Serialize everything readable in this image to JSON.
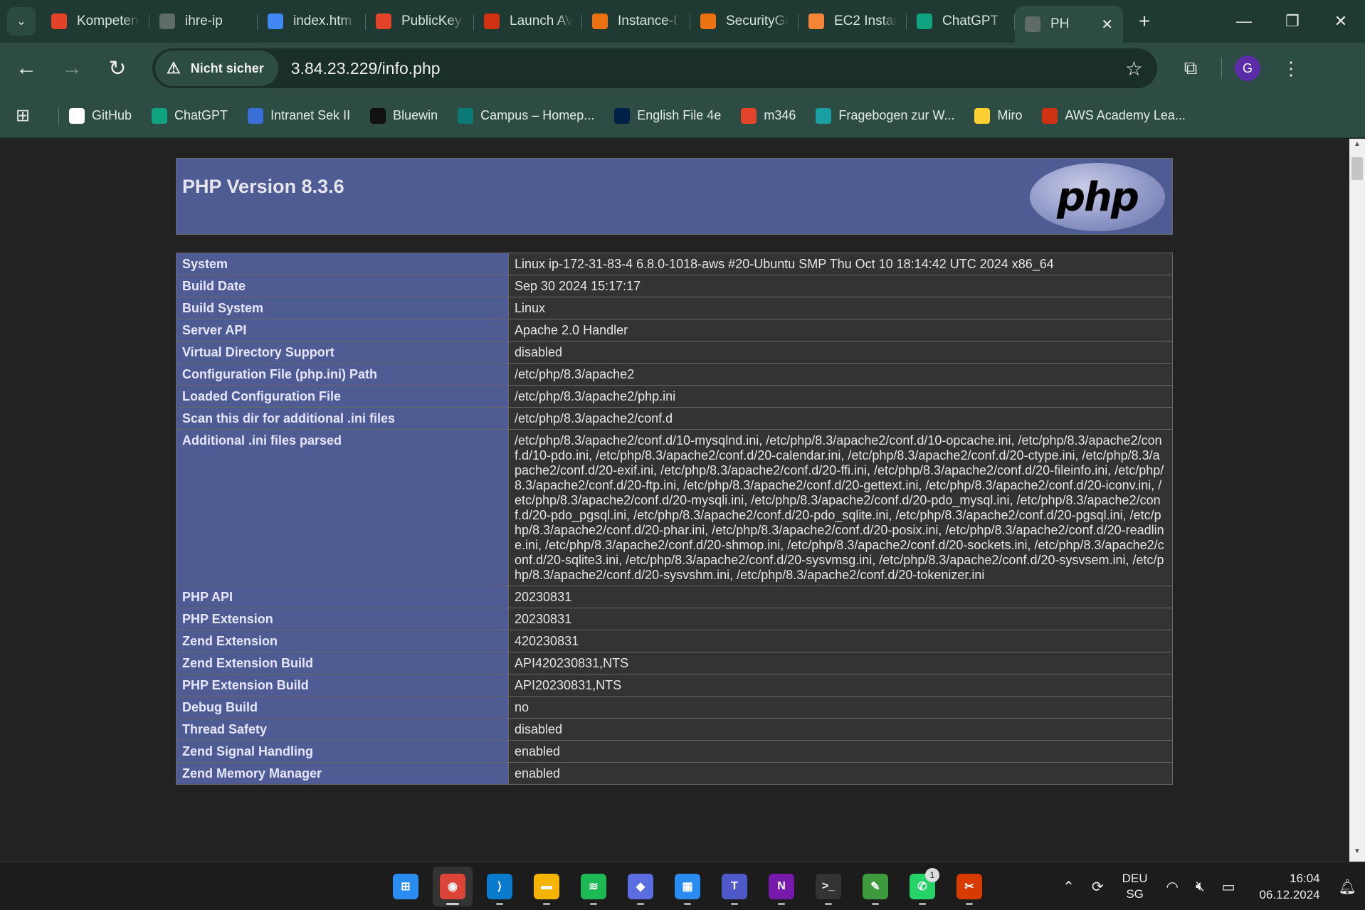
{
  "browser": {
    "tabs": [
      {
        "title": "Kompeten",
        "icon": "gitlab-icon",
        "color": "#e24329"
      },
      {
        "title": "ihre-ip",
        "icon": "globe-icon",
        "color": "#5f6b66"
      },
      {
        "title": "index.htm",
        "icon": "google-icon",
        "color": "#4285f4"
      },
      {
        "title": "PublicKey",
        "icon": "gitlab-icon",
        "color": "#e24329"
      },
      {
        "title": "Launch AV",
        "icon": "aws-academy-icon",
        "color": "#d13212"
      },
      {
        "title": "Instance-I",
        "icon": "aws-icon",
        "color": "#ec7211"
      },
      {
        "title": "SecurityGr",
        "icon": "aws-icon",
        "color": "#ec7211"
      },
      {
        "title": "EC2 Instan",
        "icon": "ec2-icon",
        "color": "#f58536"
      },
      {
        "title": "ChatGPT",
        "icon": "chatgpt-icon",
        "color": "#10a37f"
      },
      {
        "title": "PH",
        "icon": "globe-icon",
        "color": "#5f6b66",
        "active": true
      }
    ],
    "address": {
      "security_label": "Nicht sicher",
      "url": "3.84.23.229/info.php"
    },
    "profile_initial": "G",
    "bookmarks": [
      {
        "label": "GitHub",
        "icon": "github-icon",
        "color": "#ffffff"
      },
      {
        "label": "ChatGPT",
        "icon": "chatgpt-icon",
        "color": "#10a37f"
      },
      {
        "label": "Intranet Sek II",
        "icon": "intranet-icon",
        "color": "#3b6fd8"
      },
      {
        "label": "Bluewin",
        "icon": "bluewin-icon",
        "color": "#111111"
      },
      {
        "label": "Campus – Homep...",
        "icon": "sharepoint-icon",
        "color": "#0b7a75"
      },
      {
        "label": "English File 4e",
        "icon": "oxford-icon",
        "color": "#002147"
      },
      {
        "label": "m346",
        "icon": "gitlab-icon",
        "color": "#e24329"
      },
      {
        "label": "Fragebogen zur W...",
        "icon": "form-icon",
        "color": "#1aa0a3"
      },
      {
        "label": "Miro",
        "icon": "miro-icon",
        "color": "#ffd02f"
      },
      {
        "label": "AWS Academy Lea...",
        "icon": "aws-academy-icon",
        "color": "#d13212"
      }
    ]
  },
  "phpinfo": {
    "title": "PHP Version 8.3.6",
    "logo_text": "php",
    "rows": [
      {
        "key": "System",
        "value": "Linux ip-172-31-83-4 6.8.0-1018-aws #20-Ubuntu SMP Thu Oct 10 18:14:42 UTC 2024 x86_64"
      },
      {
        "key": "Build Date",
        "value": "Sep 30 2024 15:17:17"
      },
      {
        "key": "Build System",
        "value": "Linux"
      },
      {
        "key": "Server API",
        "value": "Apache 2.0 Handler"
      },
      {
        "key": "Virtual Directory Support",
        "value": "disabled"
      },
      {
        "key": "Configuration File (php.ini) Path",
        "value": "/etc/php/8.3/apache2"
      },
      {
        "key": "Loaded Configuration File",
        "value": "/etc/php/8.3/apache2/php.ini"
      },
      {
        "key": "Scan this dir for additional .ini files",
        "value": "/etc/php/8.3/apache2/conf.d"
      },
      {
        "key": "Additional .ini files parsed",
        "value": "/etc/php/8.3/apache2/conf.d/10-mysqlnd.ini, /etc/php/8.3/apache2/conf.d/10-opcache.ini, /etc/php/8.3/apache2/conf.d/10-pdo.ini, /etc/php/8.3/apache2/conf.d/20-calendar.ini, /etc/php/8.3/apache2/conf.d/20-ctype.ini, /etc/php/8.3/apache2/conf.d/20-exif.ini, /etc/php/8.3/apache2/conf.d/20-ffi.ini, /etc/php/8.3/apache2/conf.d/20-fileinfo.ini, /etc/php/8.3/apache2/conf.d/20-ftp.ini, /etc/php/8.3/apache2/conf.d/20-gettext.ini, /etc/php/8.3/apache2/conf.d/20-iconv.ini, /etc/php/8.3/apache2/conf.d/20-mysqli.ini, /etc/php/8.3/apache2/conf.d/20-pdo_mysql.ini, /etc/php/8.3/apache2/conf.d/20-pdo_pgsql.ini, /etc/php/8.3/apache2/conf.d/20-pdo_sqlite.ini, /etc/php/8.3/apache2/conf.d/20-pgsql.ini, /etc/php/8.3/apache2/conf.d/20-phar.ini, /etc/php/8.3/apache2/conf.d/20-posix.ini, /etc/php/8.3/apache2/conf.d/20-readline.ini, /etc/php/8.3/apache2/conf.d/20-shmop.ini, /etc/php/8.3/apache2/conf.d/20-sockets.ini, /etc/php/8.3/apache2/conf.d/20-sqlite3.ini, /etc/php/8.3/apache2/conf.d/20-sysvmsg.ini, /etc/php/8.3/apache2/conf.d/20-sysvsem.ini, /etc/php/8.3/apache2/conf.d/20-sysvshm.ini, /etc/php/8.3/apache2/conf.d/20-tokenizer.ini"
      },
      {
        "key": "PHP API",
        "value": "20230831"
      },
      {
        "key": "PHP Extension",
        "value": "20230831"
      },
      {
        "key": "Zend Extension",
        "value": "420230831"
      },
      {
        "key": "Zend Extension Build",
        "value": "API420230831,NTS"
      },
      {
        "key": "PHP Extension Build",
        "value": "API20230831,NTS"
      },
      {
        "key": "Debug Build",
        "value": "no"
      },
      {
        "key": "Thread Safety",
        "value": "disabled"
      },
      {
        "key": "Zend Signal Handling",
        "value": "enabled"
      },
      {
        "key": "Zend Memory Manager",
        "value": "enabled"
      }
    ]
  },
  "taskbar": {
    "apps": [
      {
        "name": "windows-start-icon",
        "glyph": "⊞",
        "color": "#2a8cf0"
      },
      {
        "name": "chrome-icon",
        "glyph": "◉",
        "color": "#db4437",
        "active": true
      },
      {
        "name": "vscode-icon",
        "glyph": "⟩",
        "color": "#0a7acc"
      },
      {
        "name": "file-explorer-icon",
        "glyph": "▬",
        "color": "#f4b400"
      },
      {
        "name": "spotify-icon",
        "glyph": "≋",
        "color": "#1db954"
      },
      {
        "name": "copilot-icon",
        "glyph": "◆",
        "color": "#5b6ee1"
      },
      {
        "name": "microsoft-store-icon",
        "glyph": "▦",
        "color": "#2a8cf0"
      },
      {
        "name": "teams-icon",
        "glyph": "T",
        "color": "#5059c9"
      },
      {
        "name": "onenote-icon",
        "glyph": "N",
        "color": "#7719aa"
      },
      {
        "name": "terminal-icon",
        "glyph": ">_",
        "color": "#333333"
      },
      {
        "name": "notepad-icon",
        "glyph": "✎",
        "color": "#3d9a3d"
      },
      {
        "name": "whatsapp-icon",
        "glyph": "✆",
        "color": "#25d366",
        "badge": "1"
      },
      {
        "name": "snipping-tool-icon",
        "glyph": "✂",
        "color": "#d83b01"
      }
    ],
    "language_line1": "DEU",
    "language_line2": "SG",
    "time": "16:04",
    "date": "06.12.2024"
  }
}
